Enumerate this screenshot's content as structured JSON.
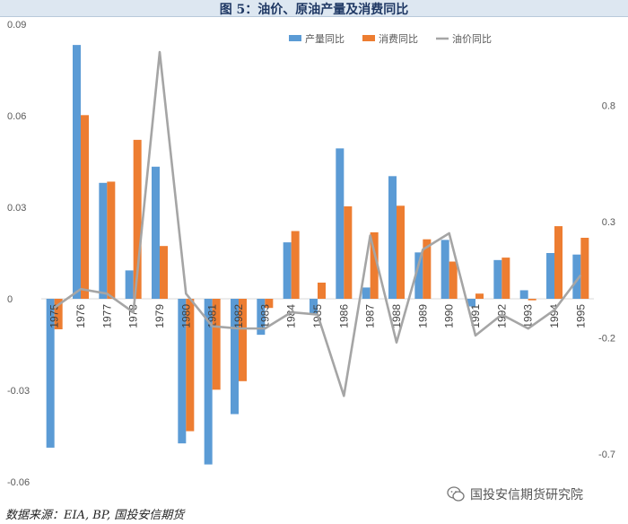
{
  "header": {
    "title": "图 5：油价、原油产量及消费同比"
  },
  "source": "数据来源：EIA, BP, 国投安信期货",
  "watermark": {
    "text": "国投安信期货研究院",
    "icon": "wechat-icon"
  },
  "chart_data": {
    "type": "bar",
    "title": "",
    "categories": [
      "1975",
      "1976",
      "1977",
      "1978",
      "1979",
      "1980",
      "1981",
      "1982",
      "1983",
      "1984",
      "1985",
      "1986",
      "1987",
      "1988",
      "1989",
      "1990",
      "1991",
      "1992",
      "1993",
      "1994",
      "1995"
    ],
    "y_left": {
      "range": [
        -0.06,
        0.09
      ],
      "ticks": [
        "0.09",
        "0.06",
        "0.03",
        "0",
        "-0.03",
        "-0.06"
      ]
    },
    "y_right": {
      "range": [
        -0.82,
        1.15
      ],
      "ticks": [
        "0.8",
        "0.3",
        "-0.2",
        "-0.7"
      ],
      "tick_values": [
        0.8,
        0.3,
        -0.2,
        -0.7
      ]
    },
    "series": [
      {
        "name": "产量同比",
        "type": "bar",
        "axis": "left",
        "color": "#5b9bd5",
        "values": [
          -0.0488,
          0.0832,
          0.038,
          0.0093,
          0.0433,
          -0.0474,
          -0.0543,
          -0.0378,
          -0.0118,
          0.0185,
          -0.005,
          0.0493,
          0.0037,
          0.0402,
          0.0152,
          0.0193,
          -0.0025,
          0.0127,
          0.0028,
          0.015,
          0.0145
        ]
      },
      {
        "name": "消费同比",
        "type": "bar",
        "axis": "left",
        "color": "#ed7d31",
        "values": [
          -0.01,
          0.0602,
          0.0384,
          0.0521,
          0.0173,
          -0.0434,
          -0.0298,
          -0.027,
          -0.003,
          0.0222,
          0.0053,
          0.0303,
          0.0218,
          0.0305,
          0.0195,
          0.0122,
          0.0017,
          0.0135,
          -0.0005,
          0.0238,
          0.02
        ]
      },
      {
        "name": "油价同比",
        "type": "line",
        "axis": "right",
        "color": "#a5a5a5",
        "values": [
          -0.07,
          0.01,
          -0.01,
          -0.09,
          1.03,
          -0.01,
          -0.15,
          -0.16,
          -0.16,
          -0.09,
          -0.1,
          -0.45,
          0.24,
          -0.22,
          0.18,
          0.25,
          -0.19,
          -0.1,
          -0.16,
          -0.08,
          0.07
        ]
      }
    ],
    "legend_position": "top-right",
    "grid": false
  }
}
